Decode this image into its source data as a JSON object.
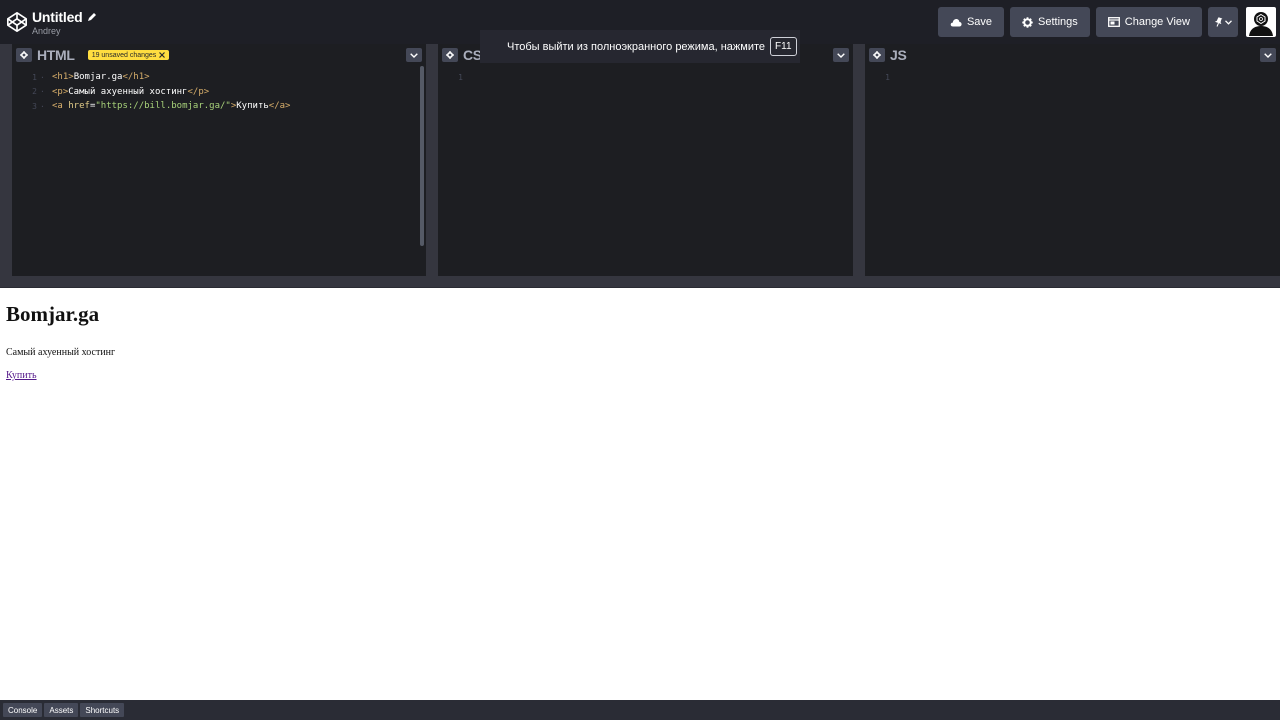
{
  "header": {
    "title": "Untitled",
    "author": "Andrey",
    "buttons": {
      "save": "Save",
      "settings": "Settings",
      "change_view": "Change View"
    }
  },
  "toast": {
    "message": "Чтобы выйти из полноэкранного режима, нажмите",
    "key": "F11"
  },
  "editors": {
    "html": {
      "title": "HTML",
      "unsaved_badge": "19 unsaved changes",
      "lines": [
        {
          "num": "1",
          "open_tag": "<h1>",
          "text": "Bomjar.ga",
          "close_tag": "</h1>"
        },
        {
          "num": "2",
          "open_tag": "<p>",
          "text": "Самый ахуенный хостинг",
          "close_tag": "</p>"
        },
        {
          "num": "3",
          "tag_start": "<a ",
          "attr": "href",
          "eq": "=",
          "str": "\"https://bill.bomjar.ga/\"",
          "tag_end": ">",
          "text": "Купить",
          "close_tag": "</a>"
        }
      ]
    },
    "css": {
      "title": "CSS",
      "line1": "1"
    },
    "js": {
      "title": "JS",
      "line1": "1"
    }
  },
  "preview": {
    "heading": "Bomjar.ga",
    "paragraph": "Самый ахуенный хостинг",
    "link": "Купить"
  },
  "footer": {
    "console": "Console",
    "assets": "Assets",
    "shortcuts": "Shortcuts"
  },
  "colors": {
    "header_bg": "#1e1f26",
    "editor_bg": "#1d1e22",
    "button_bg": "#444857",
    "badge_yellow": "#ffdd40",
    "link_visited": "#551a8b"
  }
}
